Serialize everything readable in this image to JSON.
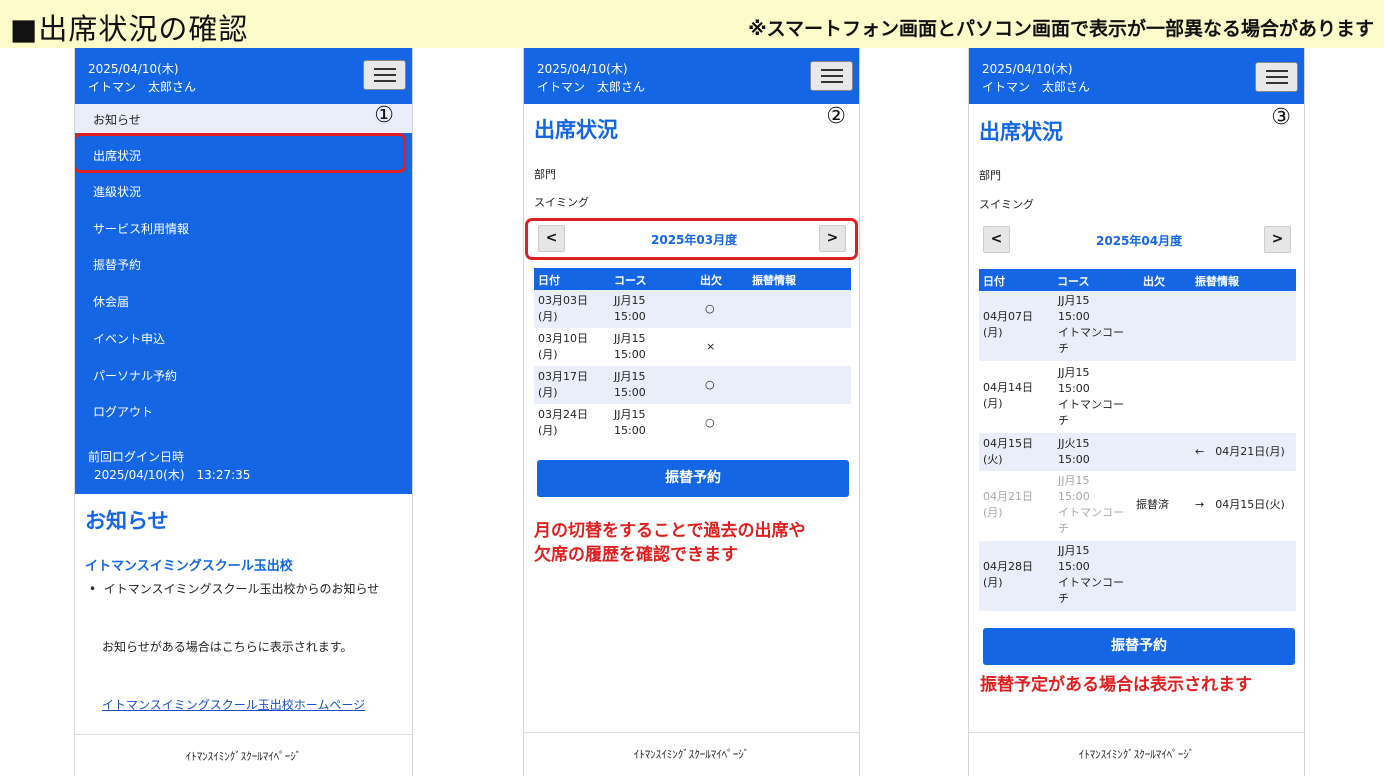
{
  "page": {
    "title": "■出席状況の確認",
    "note": "※スマートフォン画面とパソコン画面で表示が一部異なる場合があります"
  },
  "common": {
    "date": "2025/04/10(木)",
    "user": "イトマン　太郎さん",
    "footer": "ｲﾄﾏﾝｽｲﾐﾝｸﾞｽｸｰﾙﾏｲﾍﾟｰｼﾞ",
    "menu_icon": "hamburger-icon"
  },
  "phone1": {
    "step": "①",
    "menu": [
      "お知らせ",
      "出席状況",
      "進級状況",
      "サービス利用情報",
      "振替予約",
      "休会届",
      "イベント申込",
      "パーソナル予約",
      "ログアウト"
    ],
    "last_login_label": "前回ログイン日時",
    "last_login_value": "2025/04/10(木)　13:27:35",
    "notice_heading": "お知らせ",
    "school_name": "イトマンスイミングスクール玉出校",
    "bullet": "イトマンスイミングスクール玉出校からのお知らせ",
    "notice_text": "お知らせがある場合はこちらに表示されます。",
    "homepage_link": "イトマンスイミングスクール玉出校ホームページ"
  },
  "phone2": {
    "step": "②",
    "heading": "出席状況",
    "dept_label": "部門",
    "dept_value": "スイミング",
    "prev": "<",
    "next": ">",
    "month": "2025年03月度",
    "columns": [
      "日付",
      "コース",
      "出欠",
      "振替情報"
    ],
    "rows": [
      {
        "date1": "03月03日",
        "date2": "(月)",
        "course1": "JJ月15",
        "course2": "15:00",
        "att": "○",
        "info": ""
      },
      {
        "date1": "03月10日",
        "date2": "(月)",
        "course1": "JJ月15",
        "course2": "15:00",
        "att": "×",
        "info": ""
      },
      {
        "date1": "03月17日",
        "date2": "(月)",
        "course1": "JJ月15",
        "course2": "15:00",
        "att": "○",
        "info": ""
      },
      {
        "date1": "03月24日",
        "date2": "(月)",
        "course1": "JJ月15",
        "course2": "15:00",
        "att": "○",
        "info": ""
      }
    ],
    "button": "振替予約",
    "annotation1": "月の切替をすることで過去の出席や",
    "annotation2": "欠席の履歴を確認できます"
  },
  "phone3": {
    "step": "③",
    "heading": "出席状況",
    "dept_label": "部門",
    "dept_value": "スイミング",
    "prev": "<",
    "next": ">",
    "month": "2025年04月度",
    "columns": [
      "日付",
      "コース",
      "出欠",
      "振替情報"
    ],
    "rows": [
      {
        "date1": "04月07日",
        "date2": "(月)",
        "c1": "JJ月15",
        "c2": "15:00",
        "c3": "イトマンコー",
        "c4": "チ",
        "att": "",
        "info": ""
      },
      {
        "date1": "04月14日",
        "date2": "(月)",
        "c1": "JJ月15",
        "c2": "15:00",
        "c3": "イトマンコー",
        "c4": "チ",
        "att": "",
        "info": ""
      },
      {
        "date1": "04月15日",
        "date2": "(火)",
        "c1": "JJ火15",
        "c2": "15:00",
        "c3": "",
        "c4": "",
        "att": "",
        "info": "←　04月21日(月)"
      },
      {
        "date1": "04月21日",
        "date2": "(月)",
        "c1": "JJ月15",
        "c2": "15:00",
        "c3": "イトマンコー",
        "c4": "チ",
        "att": "振替済",
        "info": "→　04月15日(火)"
      },
      {
        "date1": "04月28日",
        "date2": "(月)",
        "c1": "JJ月15",
        "c2": "15:00",
        "c3": "イトマンコー",
        "c4": "チ",
        "att": "",
        "info": ""
      }
    ],
    "button": "振替予約",
    "annotation": "振替予定がある場合は表示されます"
  },
  "colors": {
    "brand": "#1466e4",
    "highlight": "#e02020",
    "banner": "#fdfbc9"
  }
}
